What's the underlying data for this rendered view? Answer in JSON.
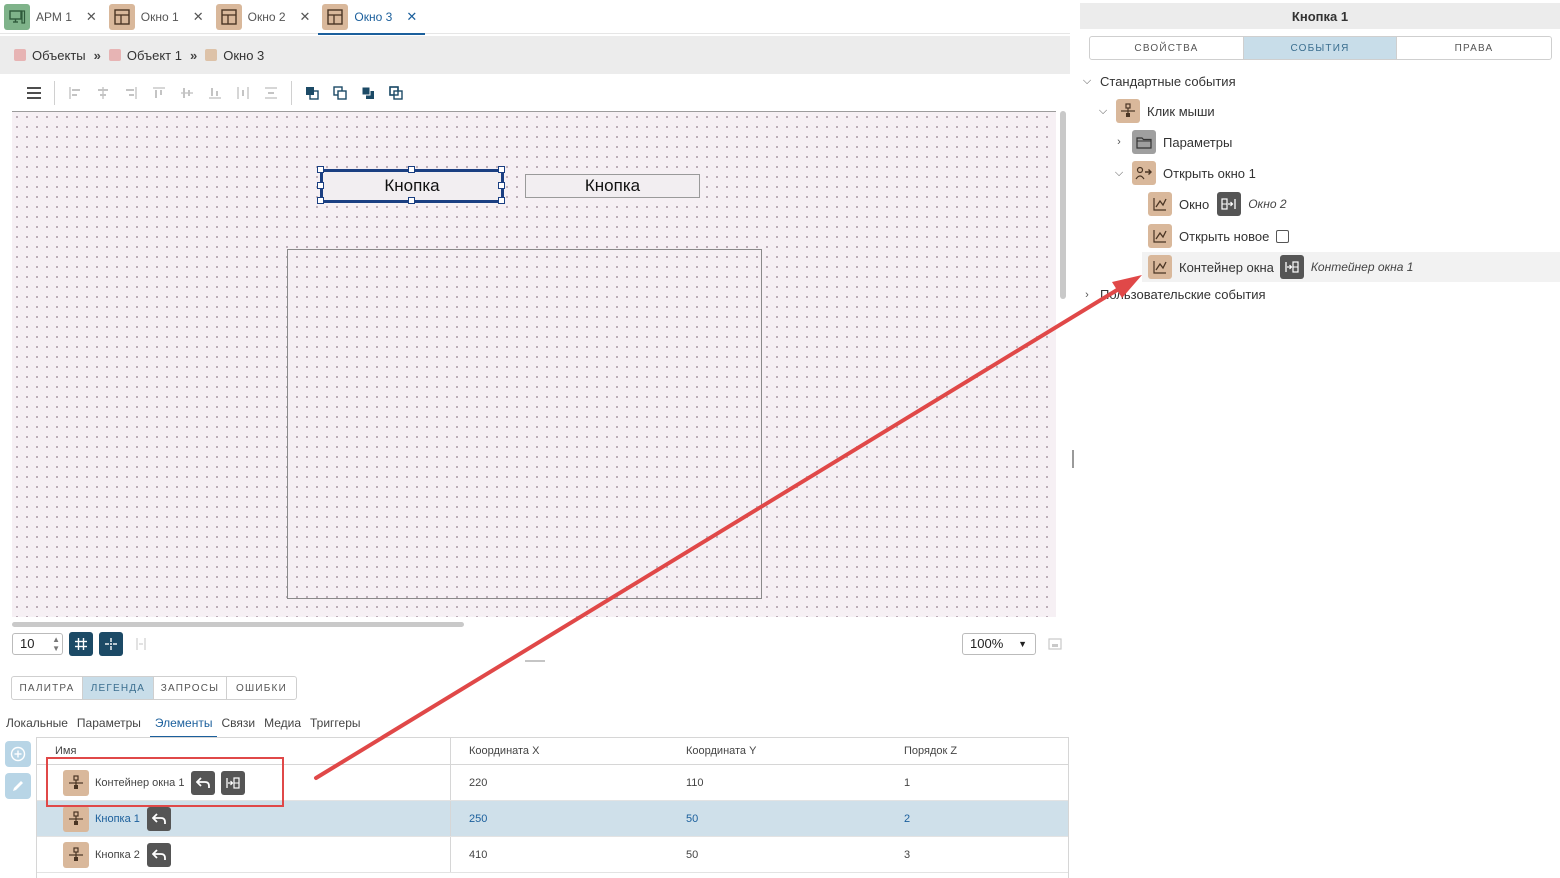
{
  "tabs": [
    {
      "label": "АРМ 1",
      "icon": "workstation-icon"
    },
    {
      "label": "Окно 1",
      "icon": "window-icon"
    },
    {
      "label": "Окно 2",
      "icon": "window-icon"
    },
    {
      "label": "Окно 3",
      "icon": "window-icon",
      "active": true
    }
  ],
  "breadcrumb": {
    "items": [
      {
        "label": "Объекты",
        "color": "#e7b4b4"
      },
      {
        "label": "Объект 1",
        "color": "#e7b4b4"
      },
      {
        "label": "Окно 3",
        "color": "#ddc2a8"
      }
    ],
    "separator": "»"
  },
  "canvas": {
    "buttons": [
      {
        "label": "Кнопка",
        "selected": true
      },
      {
        "label": "Кнопка",
        "selected": false
      }
    ]
  },
  "controls": {
    "grid_step": "10",
    "zoom": "100%"
  },
  "bottom_tabs": [
    "Палитра",
    "Легенда",
    "Запросы",
    "Ошибки"
  ],
  "bottom_tabs_active": "Легенда",
  "sub_tabs": [
    "Локальные",
    "Параметры",
    "Элементы",
    "Связи",
    "Медиа",
    "Триггеры"
  ],
  "sub_tabs_active": "Элементы",
  "table": {
    "columns": [
      "Имя",
      "Координата X",
      "Координата Y",
      "Порядок Z"
    ],
    "rows": [
      {
        "name": "Контейнер окна 1",
        "x": "220",
        "y": "110",
        "z": "1",
        "selected": false,
        "extra_link": true
      },
      {
        "name": "Кнопка 1",
        "x": "250",
        "y": "50",
        "z": "2",
        "selected": true,
        "extra_link": false
      },
      {
        "name": "Кнопка 2",
        "x": "410",
        "y": "50",
        "z": "3",
        "selected": false,
        "extra_link": false
      }
    ]
  },
  "right_panel": {
    "title": "Кнопка 1",
    "tabs": [
      "Свойства",
      "События",
      "Права"
    ],
    "active_tab": "События",
    "tree": {
      "standard_events": "Стандартные события",
      "mouse_click": "Клик мыши",
      "params": "Параметры",
      "open_window": "Открыть окно 1",
      "window_label": "Окно",
      "window_value": "Окно 2",
      "open_new_label": "Открыть новое",
      "container_label": "Контейнер окна",
      "container_value": "Контейнер окна 1",
      "user_events": "Пользовательские события"
    }
  },
  "colors": {
    "accent": "#1b5f9c",
    "selection_border": "#1b3f82",
    "active_tab_bg": "#c8dde9",
    "highlight_red": "#e04848",
    "element_icon_bg": "#d9b89b"
  }
}
